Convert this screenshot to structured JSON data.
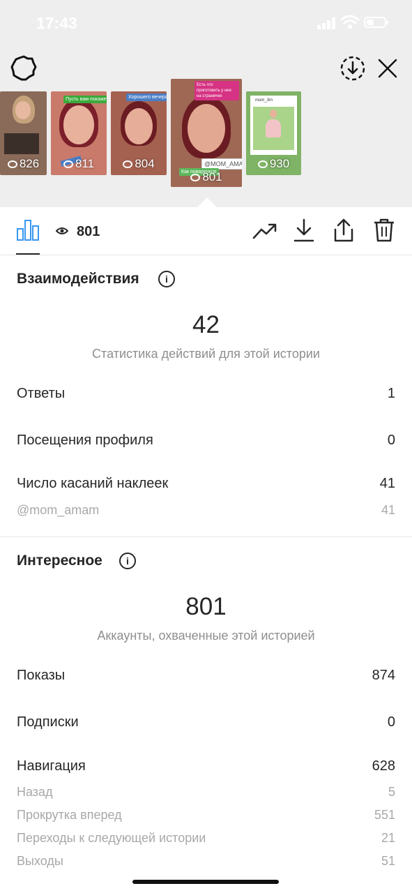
{
  "status_bar": {
    "time": "17:43"
  },
  "stories": [
    {
      "views": "826",
      "bg": "#8a6a58"
    },
    {
      "views": "811",
      "bg": "#c97a6a",
      "tag": "Пусть вам покажет"
    },
    {
      "views": "804",
      "bg": "#a4614f",
      "tag": "Хорошего вечера"
    },
    {
      "views": "801",
      "bg": "#8f5c4e",
      "tag": "@MOM_AMAM",
      "caption": "Как поваренков",
      "top_tag": "Есть что приготовить у нее на страничке"
    },
    {
      "views": "930",
      "bg": "#7fb365",
      "tag": "mom_3m"
    }
  ],
  "toolbar": {
    "reach": "801"
  },
  "interactions": {
    "title": "Взаимодействия",
    "total": "42",
    "subtitle": "Статистика действий для этой истории",
    "rows": [
      {
        "label": "Ответы",
        "value": "1"
      },
      {
        "label": "Посещения профиля",
        "value": "0"
      },
      {
        "label": "Число касаний наклеек",
        "value": "41"
      }
    ],
    "sticker": {
      "label": "@mom_amam",
      "value": "41"
    }
  },
  "discovery": {
    "title": "Интересное",
    "total": "801",
    "subtitle": "Аккаунты, охваченные этой историей",
    "rows": [
      {
        "label": "Показы",
        "value": "874"
      },
      {
        "label": "Подписки",
        "value": "0"
      },
      {
        "label": "Навигация",
        "value": "628"
      }
    ],
    "navigation": [
      {
        "label": "Назад",
        "value": "5"
      },
      {
        "label": "Прокрутка вперед",
        "value": "551"
      },
      {
        "label": "Переходы к следующей истории",
        "value": "21"
      },
      {
        "label": "Выходы",
        "value": "51"
      }
    ]
  }
}
